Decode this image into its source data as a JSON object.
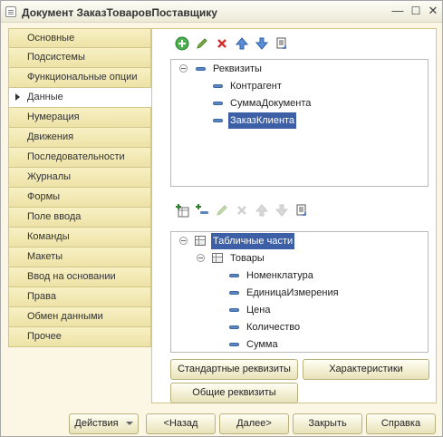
{
  "window": {
    "title": "Документ ЗаказТоваровПоставщику"
  },
  "tabs": [
    {
      "label": "Основные"
    },
    {
      "label": "Подсистемы"
    },
    {
      "label": "Функциональные опции"
    },
    {
      "label": "Данные",
      "active": true
    },
    {
      "label": "Нумерация"
    },
    {
      "label": "Движения"
    },
    {
      "label": "Последовательности"
    },
    {
      "label": "Журналы"
    },
    {
      "label": "Формы"
    },
    {
      "label": "Поле ввода"
    },
    {
      "label": "Команды"
    },
    {
      "label": "Макеты"
    },
    {
      "label": "Ввод на основании"
    },
    {
      "label": "Права"
    },
    {
      "label": "Обмен данными"
    },
    {
      "label": "Прочее"
    }
  ],
  "attributes_tree": {
    "root": "Реквизиты",
    "items": [
      "Контрагент",
      "СуммаДокумента",
      "ЗаказКлиента"
    ],
    "selected": "ЗаказКлиента"
  },
  "tabular_tree": {
    "root": "Табличные части",
    "section": "Товары",
    "items": [
      "Номенклатура",
      "ЕдиницаИзмерения",
      "Цена",
      "Количество",
      "Сумма"
    ]
  },
  "panel_buttons": {
    "standard": "Стандартные реквизиты",
    "characteristics": "Характеристики",
    "common": "Общие реквизиты"
  },
  "footer": {
    "actions": "Действия",
    "back": "<Назад",
    "next": "Далее>",
    "close": "Закрыть",
    "help": "Справка"
  },
  "icons": {
    "add": "plus-circle-icon",
    "edit": "pencil-icon",
    "delete": "red-x-icon",
    "up": "arrow-up-icon",
    "down": "arrow-down-icon",
    "list": "list-icon"
  },
  "colors": {
    "selection": "#3c5fa6",
    "tab_fill": "#efe4a8",
    "window_bg": "#fbf7e4"
  }
}
